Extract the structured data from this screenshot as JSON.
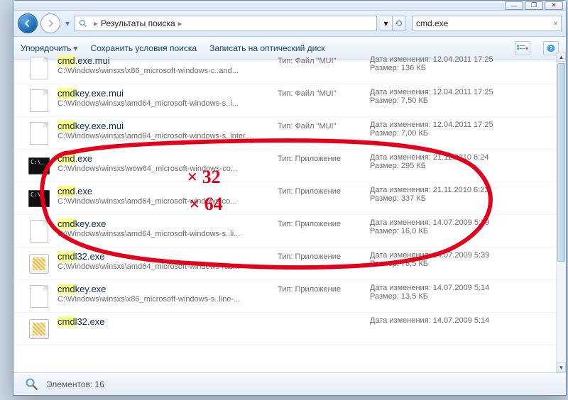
{
  "win": {
    "min": "—",
    "max": "❐",
    "close": "✕"
  },
  "address": {
    "root": "Результаты поиска",
    "arrow": "▸"
  },
  "search": {
    "value": "cmd.exe"
  },
  "toolbar": {
    "organize": "Упорядочить",
    "save_search": "Сохранить условия поиска",
    "burn": "Записать на оптический диск"
  },
  "labels": {
    "type": "Тип:",
    "modified": "Дата изменения:",
    "size": "Размер:"
  },
  "status": {
    "count_label": "Элементов:",
    "count": "16"
  },
  "items": [
    {
      "icon": "doc",
      "hl": "cmd",
      "tail": ".exe.mui",
      "path": "C:\\Windows\\winsxs\\x86_microsoft-windows-c..and...",
      "type": "Файл \"MUI\"",
      "date": "12.04.2011 17:25",
      "size": "136 КБ"
    },
    {
      "icon": "doc",
      "hl": "cmd",
      "tail": "key.exe.mui",
      "path": "C:\\Windows\\winsxs\\amd64_microsoft-windows-s..i...",
      "type": "Файл \"MUI\"",
      "date": "12.04.2011 17:25",
      "size": "7,50 КБ"
    },
    {
      "icon": "doc",
      "hl": "cmd",
      "tail": "key.exe.mui",
      "path": "C:\\Windows\\winsxs\\amd64_microsoft-windows-s..inter...",
      "type": "Файл \"MUI\"",
      "date": "12.04.2011 17:25",
      "size": "7,00 КБ"
    },
    {
      "icon": "cmd",
      "hl": "cmd",
      "tail": ".exe",
      "path": "C:\\Windows\\winsxs\\wow64_microsoft-windows-co...",
      "type": "Приложение",
      "date": "21.11.2010 6:24",
      "size": "295 КБ"
    },
    {
      "icon": "cmd",
      "hl": "cmd",
      "tail": ".exe",
      "path": "C:\\Windows\\winsxs\\amd64_microsoft-windows-co...",
      "type": "Приложение",
      "date": "21.11.2010 6:23",
      "size": "337 КБ"
    },
    {
      "icon": "doc",
      "hl": "cmd",
      "tail": "key.exe",
      "path": "C:\\Windows\\winsxs\\amd64_microsoft-windows-s..li...",
      "type": "Приложение",
      "date": "14.07.2009 5:39",
      "size": "16,0 КБ"
    },
    {
      "icon": "dll",
      "hl": "cmd",
      "tail": "l32.exe",
      "path": "C:\\Windows\\winsxs\\amd64_microsoft-windows-ras...",
      "type": "Приложение",
      "date": "14.07.2009 5:39",
      "size": "78,5 КБ"
    },
    {
      "icon": "doc",
      "hl": "cmd",
      "tail": "key.exe",
      "path": "C:\\Windows\\winsxs\\x86_microsoft-windows-s..line-...",
      "type": "Приложение",
      "date": "14.07.2009 5:14",
      "size": "13,5 КБ"
    },
    {
      "icon": "dll",
      "hl": "cmd",
      "tail": "l32.exe",
      "path": "",
      "type": "",
      "date": "14.07.2009 5:14",
      "size": ""
    }
  ],
  "annotations": {
    "t32": "× 32",
    "t64": "× 64"
  }
}
